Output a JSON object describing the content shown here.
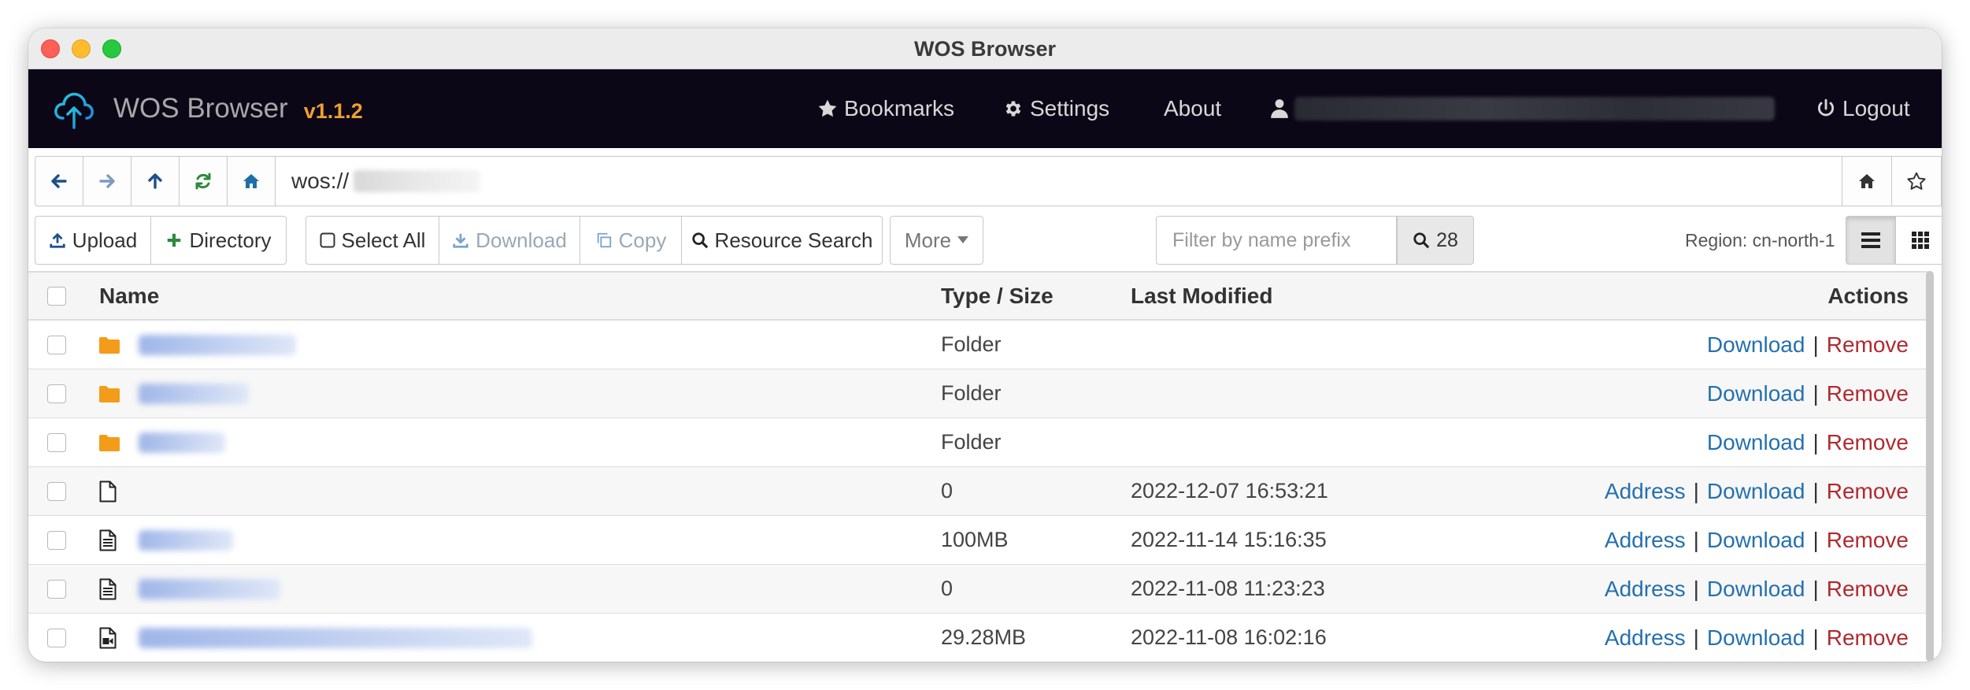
{
  "window": {
    "title": "WOS Browser"
  },
  "navbar": {
    "brand": "WOS Browser",
    "version": "v1.1.2",
    "bookmarks": "Bookmarks",
    "settings": "Settings",
    "about": "About",
    "logout": "Logout"
  },
  "addressbar": {
    "value": "wos://"
  },
  "toolbar": {
    "upload": "Upload",
    "directory": "Directory",
    "select_all": "Select All",
    "download": "Download",
    "copy": "Copy",
    "resource_search": "Resource Search",
    "more": "More",
    "filter_placeholder": "Filter by name prefix",
    "count": "28",
    "region": "Region: cn-north-1"
  },
  "table": {
    "headers": {
      "name": "Name",
      "type_size": "Type / Size",
      "last_modified": "Last Modified",
      "actions": "Actions"
    },
    "rows": [
      {
        "icon": "folder-icon",
        "type": "Folder",
        "modified": "",
        "address": "",
        "download": "Download",
        "remove": "Remove",
        "blur_w": 200
      },
      {
        "icon": "folder-icon",
        "type": "Folder",
        "modified": "",
        "address": "",
        "download": "Download",
        "remove": "Remove",
        "blur_w": 140
      },
      {
        "icon": "folder-icon",
        "type": "Folder",
        "modified": "",
        "address": "",
        "download": "Download",
        "remove": "Remove",
        "blur_w": 110
      },
      {
        "icon": "file-icon",
        "type": "0",
        "modified": "2022-12-07 16:53:21",
        "address": "Address",
        "download": "Download",
        "remove": "Remove",
        "blur_w": 0
      },
      {
        "icon": "text-file-icon",
        "type": "100MB",
        "modified": "2022-11-14 15:16:35",
        "address": "Address",
        "download": "Download",
        "remove": "Remove",
        "blur_w": 120
      },
      {
        "icon": "text-file-icon",
        "type": "0",
        "modified": "2022-11-08 11:23:23",
        "address": "Address",
        "download": "Download",
        "remove": "Remove",
        "blur_w": 180
      },
      {
        "icon": "video-file-icon",
        "type": "29.28MB",
        "modified": "2022-11-08 16:02:16",
        "address": "Address",
        "download": "Download",
        "remove": "Remove",
        "blur_w": 500
      }
    ]
  },
  "colors": {
    "navbar_bg": "#0c0717",
    "version": "#f0a030",
    "link": "#2470b0",
    "remove": "#b02a30",
    "folder": "#f39c1a"
  }
}
